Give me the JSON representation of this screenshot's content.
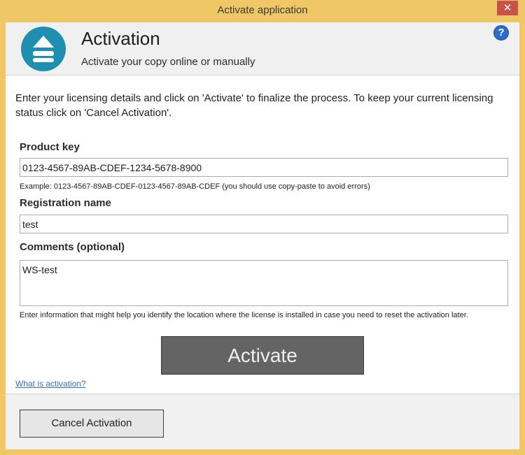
{
  "window": {
    "title": "Activate application",
    "close_glyph": "✕"
  },
  "header": {
    "title": "Activation",
    "subtitle": "Activate your copy online or manually",
    "logo_icon": "eject-icon",
    "help_glyph": "?"
  },
  "intro": "Enter your licensing details and click on 'Activate' to finalize the process. To keep your current licensing status click on 'Cancel Activation'.",
  "form": {
    "product_key_label": "Product key",
    "product_key_value": "0123-4567-89AB-CDEF-1234-5678-8900",
    "product_key_hint": "Example: 0123-4567-89AB-CDEF-0123-4567-89AB-CDEF (you should use copy-paste to avoid errors)",
    "registration_label": "Registration name",
    "registration_value": "test",
    "comments_label": "Comments (optional)",
    "comments_value": "WS-test",
    "comments_hint": "Enter information that might help you identify the location where the license is installed in case you need to reset the activation later."
  },
  "actions": {
    "activate_label": "Activate",
    "what_is_link": "What is activation?",
    "cancel_label": "Cancel Activation"
  },
  "colors": {
    "frame": "#f0c765",
    "close": "#c9514a",
    "logo": "#1f8fb0",
    "help": "#2e6bc8",
    "activate_button": "#646464",
    "link": "#3b6fb6"
  }
}
